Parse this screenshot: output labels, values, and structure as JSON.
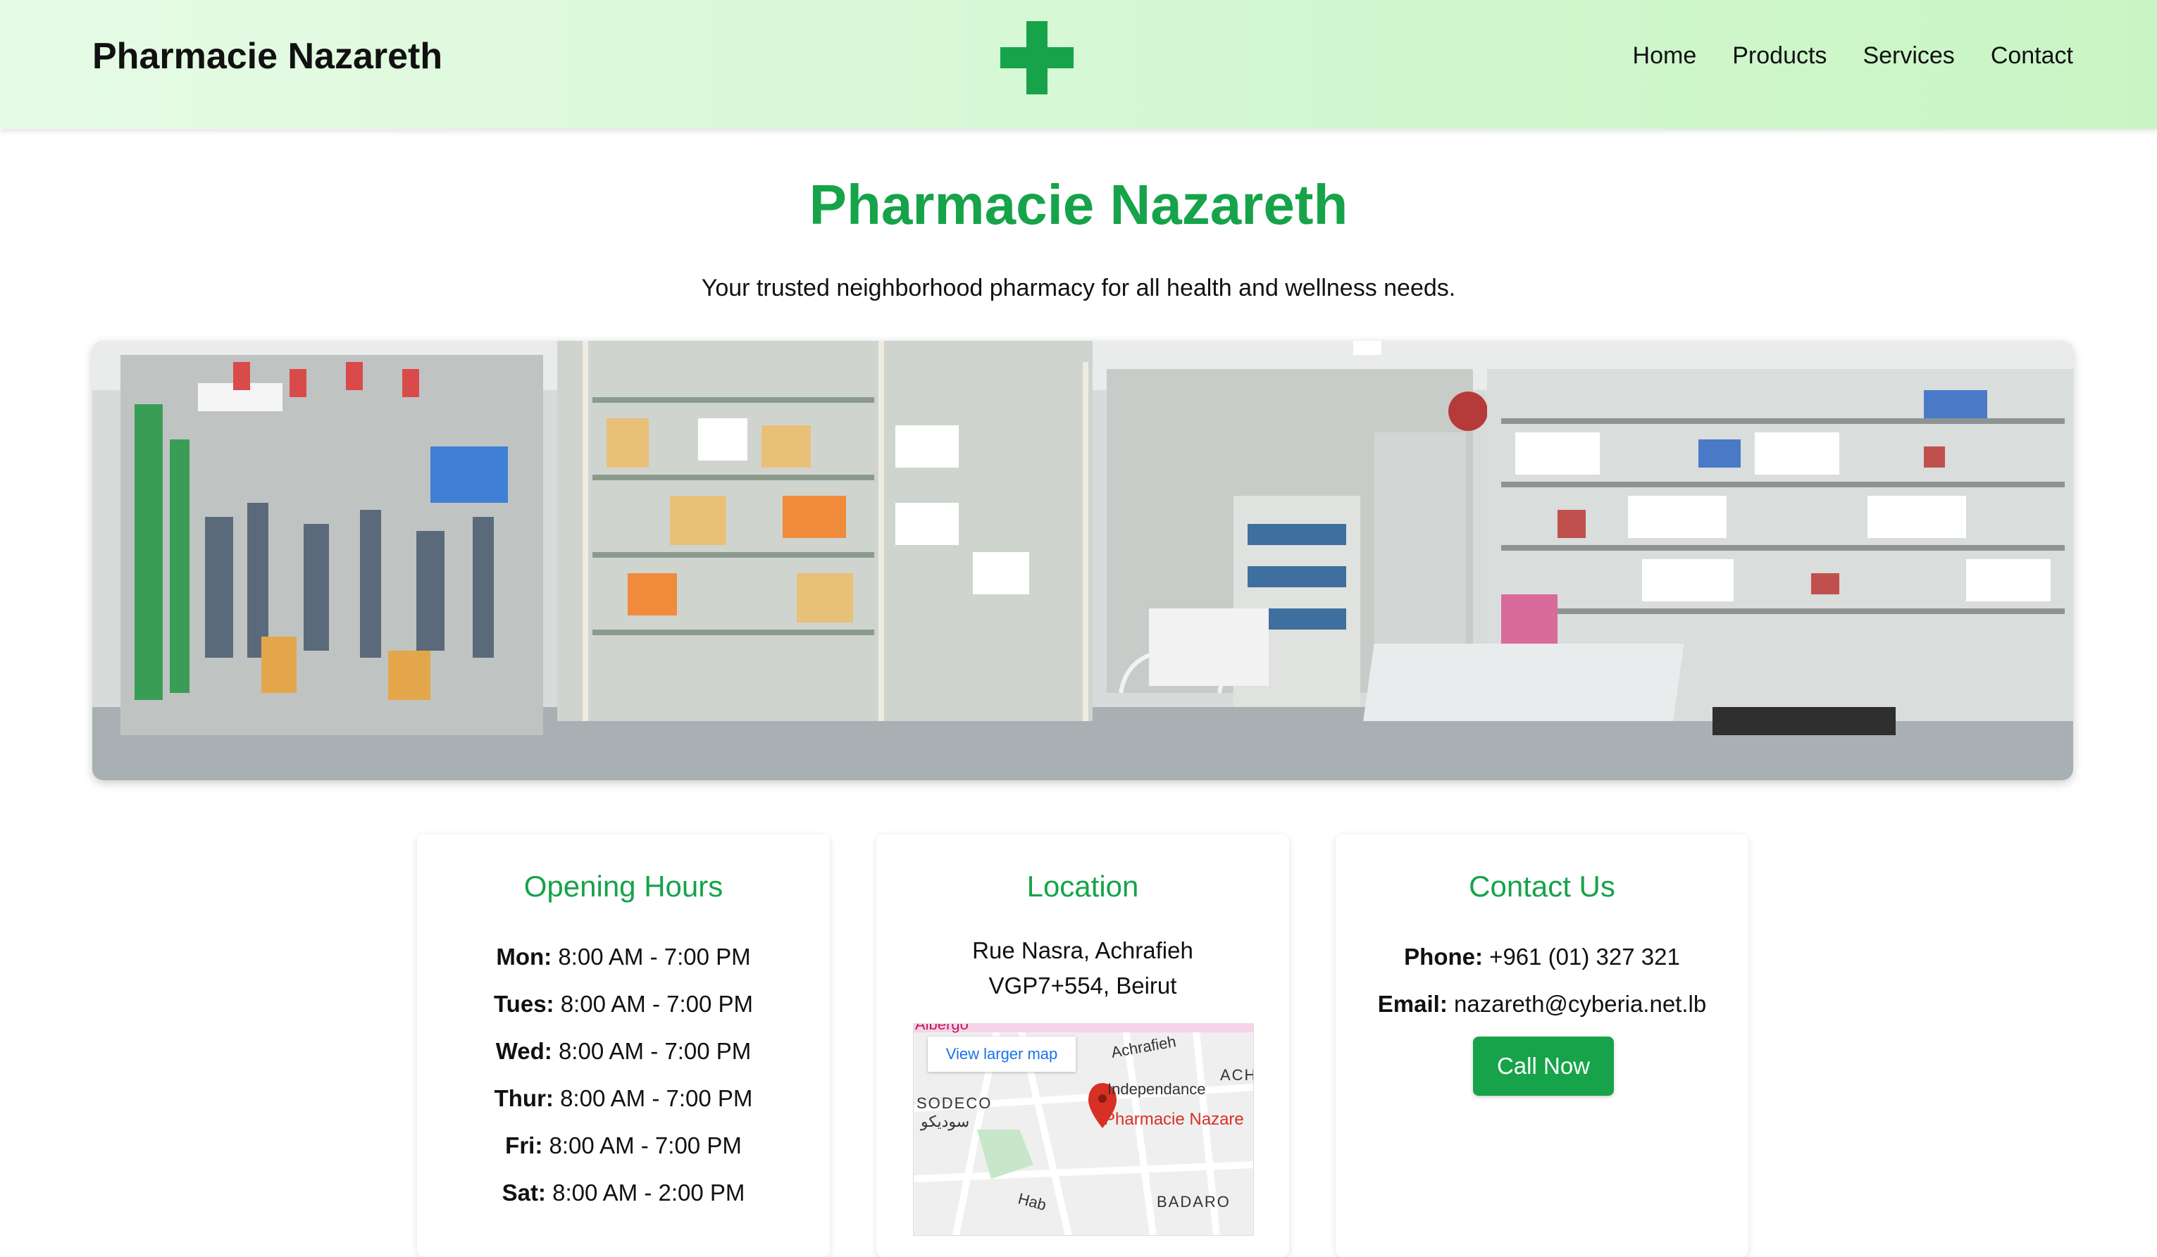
{
  "header": {
    "brand": "Pharmacie Nazareth",
    "logo_icon": "green-cross-icon",
    "nav": [
      "Home",
      "Products",
      "Services",
      "Contact"
    ]
  },
  "hero": {
    "title": "Pharmacie Nazareth",
    "tagline": "Your trusted neighborhood pharmacy for all health and wellness needs."
  },
  "hours": {
    "title": "Opening Hours",
    "rows": [
      {
        "day": "Mon:",
        "time": "8:00 AM - 7:00 PM"
      },
      {
        "day": "Tues:",
        "time": "8:00 AM - 7:00 PM"
      },
      {
        "day": "Wed:",
        "time": "8:00 AM - 7:00 PM"
      },
      {
        "day": "Thur:",
        "time": "8:00 AM - 7:00 PM"
      },
      {
        "day": "Fri:",
        "time": "8:00 AM - 7:00 PM"
      },
      {
        "day": "Sat:",
        "time": "8:00 AM - 2:00 PM"
      }
    ]
  },
  "location": {
    "title": "Location",
    "address_line1": "Rue Nasra, Achrafieh",
    "address_line2": "VGP7+554, Beirut",
    "map": {
      "view_larger": "View larger map",
      "labels": [
        "Albergo",
        "Achrafieh",
        "ACH",
        "Independance",
        "SODECO",
        "سوديكو",
        "BADARO",
        "Hab"
      ],
      "pin_label": "Pharmacie Nazare"
    }
  },
  "contact": {
    "title": "Contact Us",
    "phone_label": "Phone:",
    "phone": "+961 (01) 327 321",
    "email_label": "Email:",
    "email": "nazareth@cyberia.net.lb",
    "call_button": "Call Now"
  },
  "colors": {
    "accent": "#16a34a",
    "header_start": "#e6fbe6",
    "header_end": "#c9f5c4"
  }
}
